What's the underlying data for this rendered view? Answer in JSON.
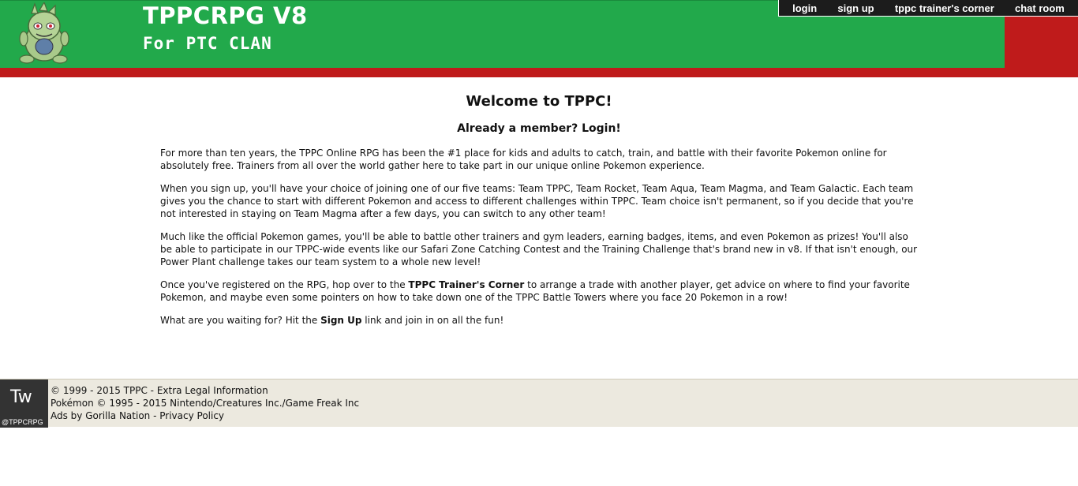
{
  "header": {
    "title": "TPPCRPG V8",
    "subtitle": "For PTC CLAN",
    "logo_icon": "tyranitar-logo-icon",
    "colors": {
      "green": "#22a94b",
      "red": "#bf1b1b",
      "nav_bg": "#1c1c1c"
    }
  },
  "nav": {
    "login": "login",
    "signup": "sign up",
    "trainers_corner": "tppc trainer's corner",
    "chat": "chat room"
  },
  "main": {
    "welcome": "Welcome to TPPC!",
    "member_prefix": "Already a member? ",
    "member_link": "Login!",
    "p1": "For more than ten years, the TPPC Online RPG has been the #1 place for kids and adults to catch, train, and battle with their favorite Pokemon online for absolutely free. Trainers from all over the world gather here to take part in our unique online Pokemon experience.",
    "p2": "When you sign up, you'll have your choice of joining one of our five teams: Team TPPC, Team Rocket, Team Aqua, Team Magma, and Team Galactic. Each team gives you the chance to start with different Pokemon and access to different challenges within TPPC. Team choice isn't permanent, so if you decide that you're not interested in staying on Team Magma after a few days, you can switch to any other team!",
    "p3": "Much like the official Pokemon games, you'll be able to battle other trainers and gym leaders, earning badges, items, and even Pokemon as prizes! You'll also be able to participate in our TPPC-wide events like our Safari Zone Catching Contest and the Training Challenge that's brand new in v8. If that isn't enough, our Power Plant challenge takes our team system to a whole new level!",
    "p4_before": "Once you've registered on the RPG, hop over to the ",
    "p4_link": "TPPC Trainer's Corner",
    "p4_after": " to arrange a trade with another player, get advice on where to find your favorite Pokemon, and maybe even some pointers on how to take down one of the TPPC Battle Towers where you face 20 Pokemon in a row!",
    "p5_before": "What are you waiting for? Hit the ",
    "p5_link": "Sign Up",
    "p5_after": " link and join in on all the fun!"
  },
  "footer": {
    "tw_label": "Tw",
    "tw_handle": "@TPPCRPG",
    "line1_prefix": "© 1999 - 2015 TPPC - ",
    "line1_link": "Extra Legal Information",
    "line2": "Pokémon © 1995 - 2015 Nintendo/Creatures Inc./Game Freak Inc",
    "line3_link1": "Ads by Gorilla Nation",
    "line3_sep": " - ",
    "line3_link2": "Privacy Policy"
  }
}
